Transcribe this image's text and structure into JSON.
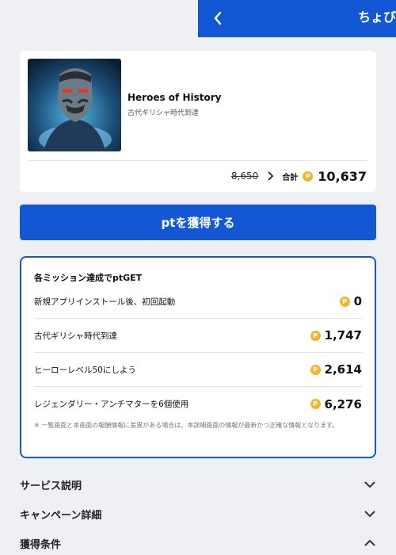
{
  "header": {
    "title": "ちょびリッチ",
    "color": "#1457d4"
  },
  "game": {
    "name": "Heroes of History",
    "subtitle": "古代ギリシャ時代到達"
  },
  "points": {
    "old": "8,650",
    "total_label": "合計",
    "total": "10,637",
    "coin_symbol": "P"
  },
  "get_button": {
    "label": "ptを獲得する"
  },
  "missions": {
    "heading": "各ミッション達成でptGET",
    "items": [
      {
        "label": "新規アプリインストール後、初回起動",
        "points": "0"
      },
      {
        "label": "古代ギリシャ時代到達",
        "points": "1,747"
      },
      {
        "label": "ヒーローレベル50にしよう",
        "points": "2,614"
      },
      {
        "label": "レジェンダリー・アンチマターを6個使用",
        "points": "6,276"
      }
    ],
    "note": "※ 一覧画面と本画面の報酬情報に差異がある場合は、本詳細画面の情報が最新かつ正確な情報となります。"
  },
  "sections": [
    {
      "label": "サービス説明",
      "state": "collapsed"
    },
    {
      "label": "キャンペーン詳細",
      "state": "collapsed"
    },
    {
      "label": "獲得条件",
      "state": "expanded"
    }
  ]
}
